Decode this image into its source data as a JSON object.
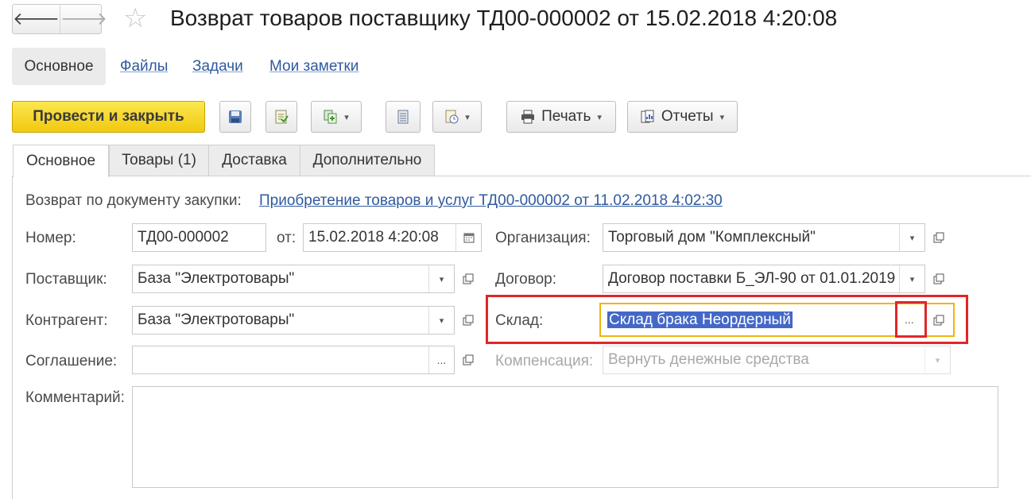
{
  "window": {
    "title": "Возврат товаров поставщику ТД00-000002 от 15.02.2018 4:20:08",
    "back_glyph": "🡐",
    "forward_glyph": "🡒",
    "favorite_icon": "star-icon"
  },
  "sections": {
    "active": "Основное",
    "links": [
      "Файлы",
      "Задачи",
      "Мои заметки"
    ]
  },
  "toolbar": {
    "post_close": "Провести и закрыть",
    "save_icon": "save-icon",
    "post_icon": "post-icon",
    "create_based_icon": "create-based-icon",
    "list_icon": "list-icon",
    "structure_icon": "structure-icon",
    "print": "Печать",
    "reports": "Отчеты"
  },
  "tabs": [
    "Основное",
    "Товары (1)",
    "Доставка",
    "Дополнительно"
  ],
  "form": {
    "basis_label": "Возврат по документу закупки:",
    "basis_link": "Приобретение товаров и услуг ТД00-000002 от 11.02.2018 4:02:30",
    "number_label": "Номер:",
    "number_value": "ТД00-000002",
    "date_label": "от:",
    "date_value": "15.02.2018  4:20:08",
    "supplier_label": "Поставщик:",
    "supplier_value": "База \"Электротовары\"",
    "counterparty_label": "Контрагент:",
    "counterparty_value": "База \"Электротовары\"",
    "agreement_label": "Соглашение:",
    "agreement_value": "",
    "organization_label": "Организация:",
    "organization_value": "Торговый дом \"Комплексный\"",
    "contract_label": "Договор:",
    "contract_value": "Договор поставки Б_ЭЛ-90 от 01.01.2019",
    "warehouse_label": "Склад:",
    "warehouse_value": "Склад брака Неордерный",
    "compensation_label": "Компенсация:",
    "compensation_value": "Вернуть денежные средства",
    "comment_label": "Комментарий:",
    "comment_value": "",
    "ellipsis": "...",
    "dropdown_glyph": "▾"
  },
  "colors": {
    "primary_button": "#f5d523",
    "highlight_border": "#e0262a",
    "focus_border": "#f1b40f",
    "selection": "#4468c8",
    "link": "#2f5a9e"
  }
}
